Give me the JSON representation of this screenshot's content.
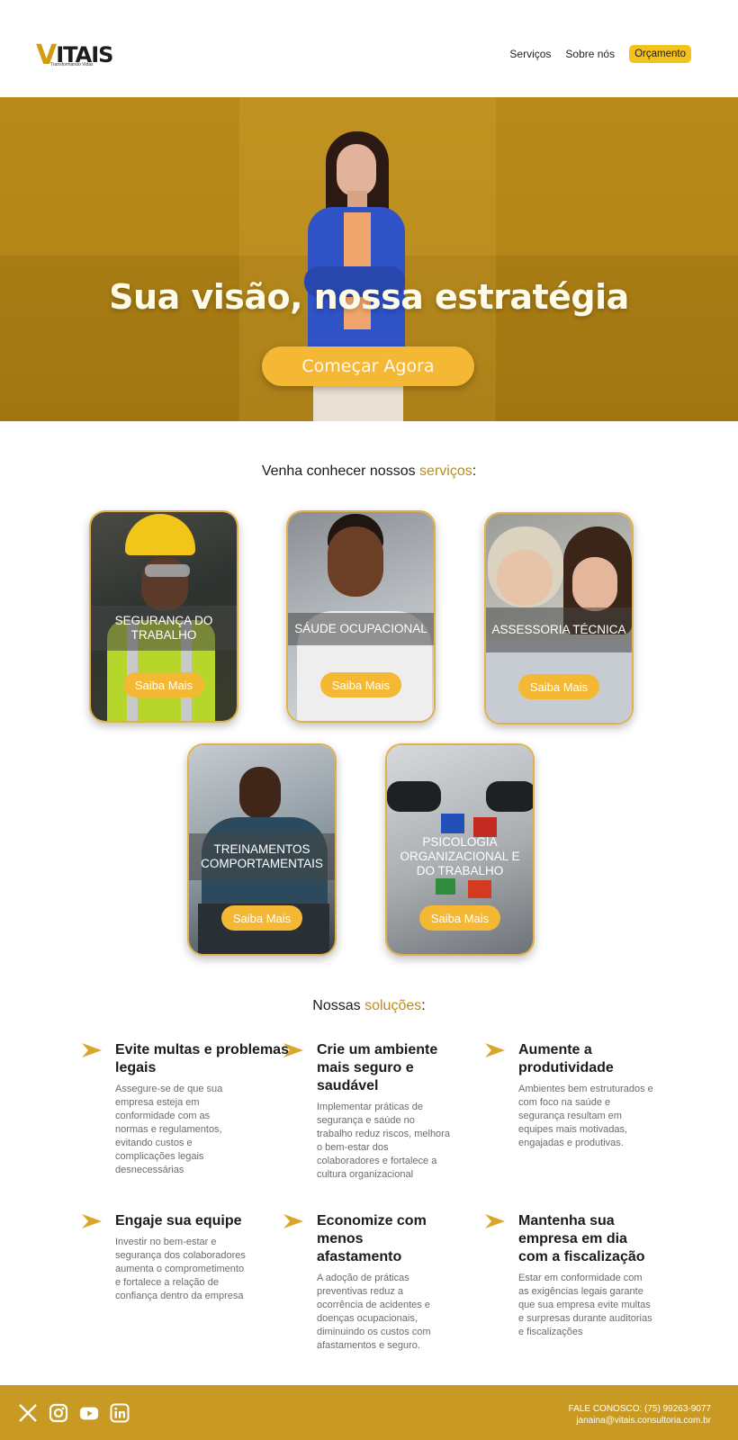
{
  "header": {
    "logo_text": "ITAIS",
    "logo_letter": "V",
    "logo_tagline": "Transformando Vidas",
    "nav": [
      {
        "label": "Serviços"
      },
      {
        "label": "Sobre nós"
      }
    ],
    "cta_label": "Orçamento"
  },
  "hero": {
    "title": "Sua visão, nossa estratégia",
    "cta_label": "Começar Agora"
  },
  "services": {
    "title_prefix": "Venha conhecer nossos ",
    "title_accent": "serviços",
    "title_suffix": ":",
    "cards": [
      {
        "label": "SEGURANÇA DO TRABALHO",
        "button": "Saiba Mais"
      },
      {
        "label": "SÁUDE OCUPACIONAL",
        "button": "Saiba Mais"
      },
      {
        "label": "ASSESSORIA TÉCNICA",
        "button": "Saiba Mais"
      },
      {
        "label": "TREINAMENTOS COMPORTAMENTAIS",
        "button": "Saiba Mais"
      },
      {
        "label": "PSICOLOGIA ORGANIZACIONAL E DO TRABALHO",
        "button": "Saiba Mais"
      }
    ]
  },
  "solutions": {
    "title_prefix": "Nossas ",
    "title_accent": "soluções",
    "title_suffix": ":",
    "items": [
      {
        "title": "Evite multas e problemas legais",
        "text": "Assegure-se de que sua empresa esteja em conformidade com as normas e regulamentos, evitando custos e complicações legais desnecessárias"
      },
      {
        "title": "Crie um ambiente mais seguro e saudável",
        "text": "Implementar práticas de segurança e saúde no trabalho reduz riscos, melhora o bem-estar dos colaboradores e fortalece a cultura organizacional"
      },
      {
        "title": "Aumente a produtividade",
        "text": "Ambientes bem estruturados e com foco na saúde e segurança resultam em equipes mais motivadas, engajadas e produtivas."
      },
      {
        "title": "Engaje sua equipe",
        "text": "Investir no bem-estar e segurança dos colaboradores aumenta o comprometimento e fortalece a relação de confiança dentro da empresa"
      },
      {
        "title": "Economize com menos afastamento",
        "text": "A adoção de práticas preventivas reduz a ocorrência de acidentes e doenças ocupacionais, diminuindo os custos com afastamentos e seguro."
      },
      {
        "title": "Mantenha sua empresa em dia com a fiscalização",
        "text": "Estar em conformidade com as exigências legais garante que sua empresa evite multas e surpresas durante auditorias e fiscalizações"
      }
    ]
  },
  "footer": {
    "phone": "FALE CONOSCO: (75) 99263-9077",
    "email": "janaina@vitais.consultoria.com.br"
  },
  "colors": {
    "accent": "#f5b834",
    "hero": "#b48618",
    "footer": "#c89a24"
  }
}
